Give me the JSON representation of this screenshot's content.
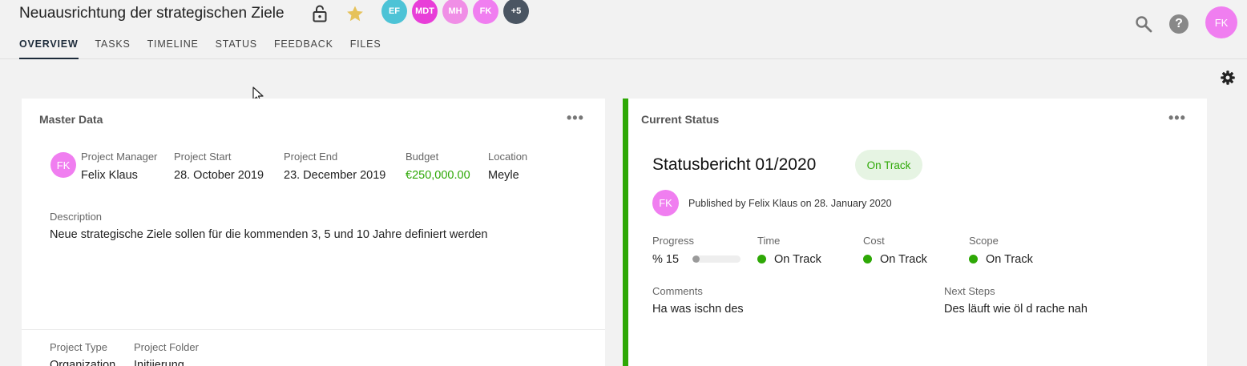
{
  "header": {
    "title": "Neuausrichtung der strategischen Ziele",
    "tabs": [
      "OVERVIEW",
      "TASKS",
      "TIMELINE",
      "STATUS",
      "FEEDBACK",
      "FILES"
    ],
    "active_tab": 0,
    "members": [
      {
        "initials": "EF",
        "color": "#4dc3d6"
      },
      {
        "initials": "MDT",
        "color": "#e83ed8"
      },
      {
        "initials": "MH",
        "color": "#f08ee6"
      },
      {
        "initials": "FK",
        "color": "#f07ef0"
      },
      {
        "initials": "+5",
        "color": "#4a5562"
      }
    ],
    "user_initials": "FK",
    "accent_avatar": "#f07ef0",
    "star_color": "#e6c25a"
  },
  "master": {
    "title": "Master Data",
    "more": "•••",
    "pm_initials": "FK",
    "project_manager_label": "Project Manager",
    "project_manager": "Felix Klaus",
    "start_label": "Project Start",
    "start": "28. October 2019",
    "end_label": "Project End",
    "end": "23. December 2019",
    "budget_label": "Budget",
    "budget": "€250,000.00",
    "location_label": "Location",
    "location": "Meyle",
    "description_label": "Description",
    "description": "Neue strategische Ziele sollen für die kommenden 3, 5 und 10 Jahre definiert werden",
    "type_label": "Project Type",
    "type": "Organization",
    "folder_label": "Project Folder",
    "folder": "Initiierung"
  },
  "status": {
    "title": "Current Status",
    "more": "•••",
    "report_title": "Statusbericht 01/2020",
    "badge": "On Track",
    "publisher_initials": "FK",
    "published": "Published by Felix Klaus on 28. January 2020",
    "progress_label": "Progress",
    "progress_text": "% 15",
    "progress_value": 15,
    "time_label": "Time",
    "time": "On Track",
    "cost_label": "Cost",
    "cost": "On Track",
    "scope_label": "Scope",
    "scope": "On Track",
    "comments_label": "Comments",
    "comments": "Ha was ischn des",
    "next_label": "Next Steps",
    "next": "Des läuft wie öl d rache nah",
    "ok_color": "#2ea806"
  }
}
